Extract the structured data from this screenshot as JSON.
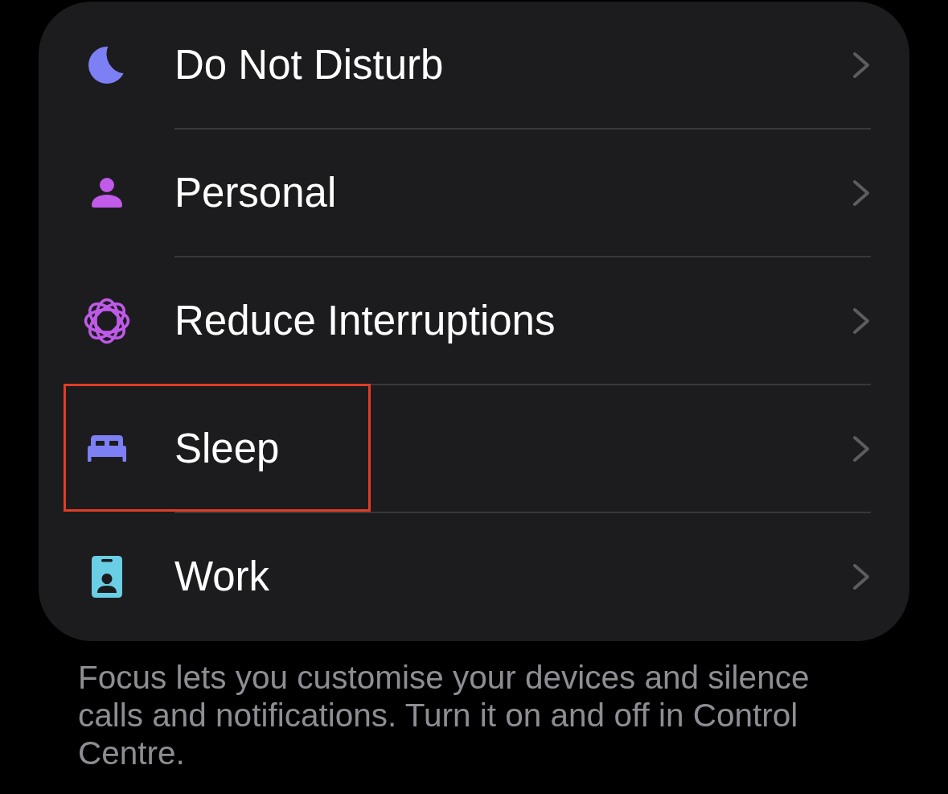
{
  "focus_modes": [
    {
      "label": "Do Not Disturb",
      "kind": "moon",
      "color": "#7d7ff5",
      "highlighted": false
    },
    {
      "label": "Personal",
      "kind": "person",
      "color": "#c25aea",
      "highlighted": false
    },
    {
      "label": "Reduce Interruptions",
      "kind": "loops",
      "color": "#bf5ae8",
      "highlighted": false
    },
    {
      "label": "Sleep",
      "kind": "bed",
      "color": "#7d7ff5",
      "highlighted": true
    },
    {
      "label": "Work",
      "kind": "badge",
      "color": "#6acfe4",
      "highlighted": false
    }
  ],
  "footer": "Focus lets you customise your devices and silence calls and notifications. Turn it on and off in Control Centre."
}
